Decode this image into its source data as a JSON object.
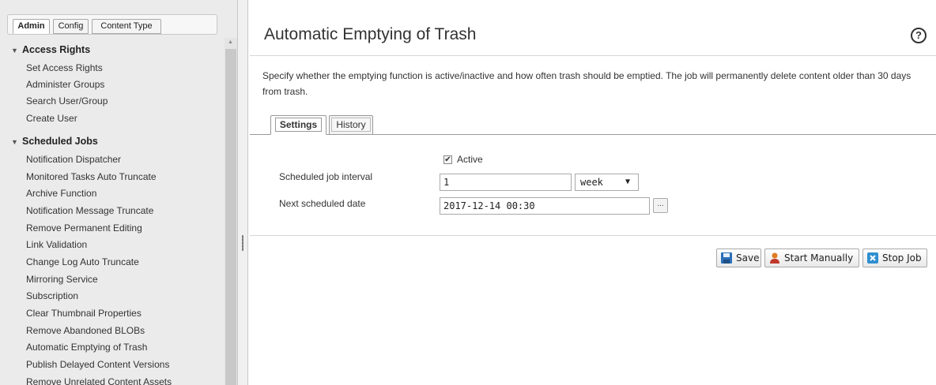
{
  "left_panel": {
    "tabs": [
      {
        "label": "Admin"
      },
      {
        "label": "Config"
      },
      {
        "label": "Content Type"
      }
    ],
    "groups": [
      {
        "label": "Access Rights",
        "items": [
          "Set Access Rights",
          "Administer Groups",
          "Search User/Group",
          "Create User"
        ]
      },
      {
        "label": "Scheduled Jobs",
        "items": [
          "Notification Dispatcher",
          "Monitored Tasks Auto Truncate",
          "Archive Function",
          "Notification Message Truncate",
          "Remove Permanent Editing",
          "Link Validation",
          "Change Log Auto Truncate",
          "Mirroring Service",
          "Subscription",
          "Clear Thumbnail Properties",
          "Remove Abandoned BLOBs",
          "Automatic Emptying of Trash",
          "Publish Delayed Content Versions",
          "Remove Unrelated Content Assets"
        ]
      }
    ]
  },
  "main": {
    "title": "Automatic Emptying of Trash",
    "help": "?",
    "description": "Specify whether the emptying function is active/inactive and how often trash should be emptied. The job will permanently delete content older than 30 days from trash.",
    "tabs": [
      {
        "label": "Settings",
        "active": true
      },
      {
        "label": "History",
        "active": false
      }
    ],
    "form": {
      "active_label": "Active",
      "active_checked": true,
      "interval_label": "Scheduled job interval",
      "interval_value": "1",
      "interval_unit": "week",
      "next_date_label": "Next scheduled date",
      "next_date_value": "2017-12-14 00:30",
      "picker_label": "..."
    },
    "buttons": {
      "save": "Save",
      "start": "Start Manually",
      "stop": "Stop Job"
    }
  },
  "colors": {
    "panel_bg": "#ebebeb",
    "save_icon": "#2a6fb8",
    "start_icon": "#e07b20",
    "stop_icon": "#2f8fd0"
  }
}
